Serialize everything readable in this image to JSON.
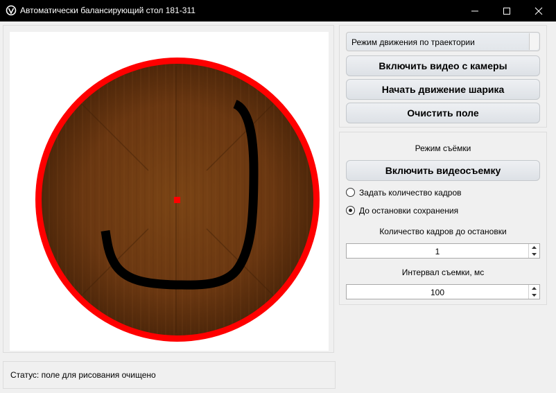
{
  "window": {
    "title": "Автоматически балансирующий стол 181-311",
    "app_icon": "app-logo-icon",
    "controls": [
      "minimize-icon",
      "maximize-icon",
      "close-icon"
    ]
  },
  "canvas": {
    "rim_color": "#ff0000",
    "board_color": "#6b3a13",
    "center_marker_color": "#ff0000",
    "trajectory_color": "#000000"
  },
  "controls": {
    "mode_select": {
      "value": "Режим движения по траектории"
    },
    "camera_button": "Включить видео с камеры",
    "start_ball_button": "Начать движение шарика",
    "clear_button": "Очистить поле"
  },
  "recording": {
    "section_title": "Режим съёмки",
    "record_button": "Включить видеосъемку",
    "options": [
      {
        "label": "Задать количество кадров",
        "selected": false
      },
      {
        "label": "До остановки сохранения",
        "selected": true
      }
    ],
    "frames_label": "Количество кадров до остановки",
    "frames_value": "1",
    "interval_label": "Интервал съемки, мс",
    "interval_value": "100"
  },
  "status": {
    "text": "Статус: поле для рисования очищено"
  }
}
